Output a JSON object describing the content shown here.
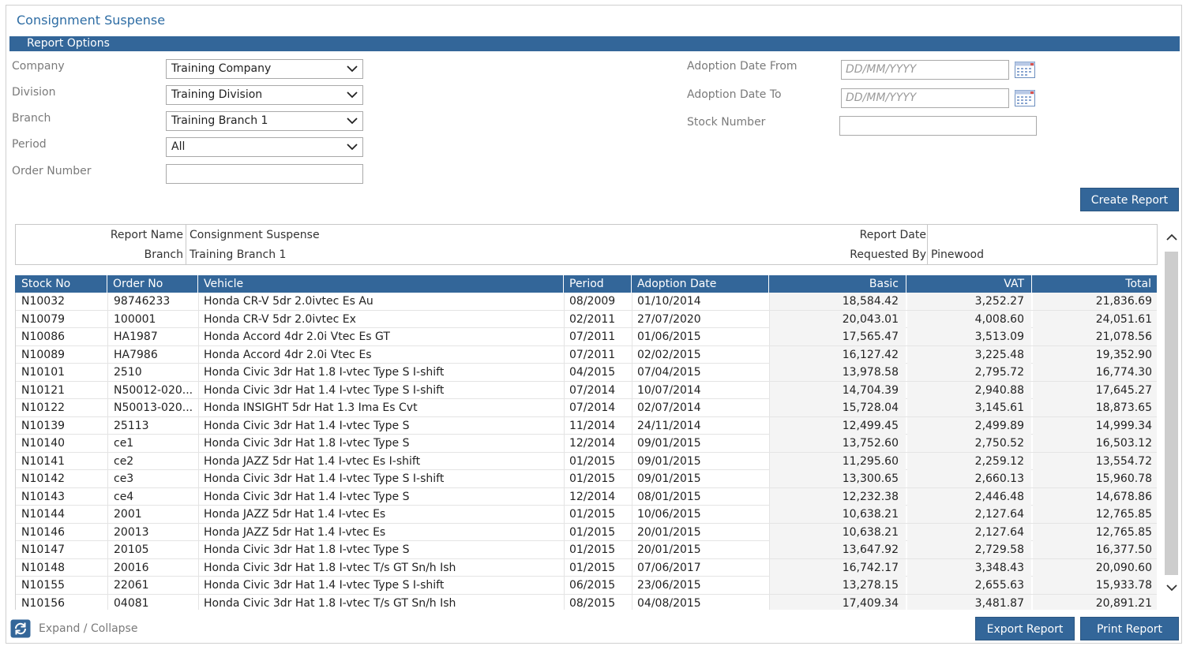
{
  "page": {
    "title": "Consignment Suspense"
  },
  "report_options": {
    "header": "Report Options",
    "company": {
      "label": "Company",
      "value": "Training Company"
    },
    "division": {
      "label": "Division",
      "value": "Training Division"
    },
    "branch": {
      "label": "Branch",
      "value": "Training Branch 1"
    },
    "period": {
      "label": "Period",
      "value": "All"
    },
    "order_number": {
      "label": "Order Number",
      "value": ""
    },
    "adoption_date_from": {
      "label": "Adoption Date From",
      "placeholder": "DD/MM/YYYY"
    },
    "adoption_date_to": {
      "label": "Adoption Date To",
      "placeholder": "DD/MM/YYYY"
    },
    "stock_number": {
      "label": "Stock Number",
      "value": ""
    },
    "create_report_label": "Create Report"
  },
  "report_info": {
    "report_name_label": "Report Name",
    "report_name_value": "Consignment Suspense",
    "branch_label": "Branch",
    "branch_value": "Training Branch 1",
    "report_date_label": "Report Date",
    "report_date_value": "",
    "requested_by_label": "Requested By",
    "requested_by_value": "Pinewood"
  },
  "table": {
    "columns": [
      "Stock No",
      "Order No",
      "Vehicle",
      "Period",
      "Adoption Date",
      "Basic",
      "VAT",
      "Total"
    ],
    "rows": [
      [
        "N10032",
        "98746233",
        "Honda CR-V 5dr 2.0ivtec Es Au",
        "08/2009",
        "01/10/2014",
        "18,584.42",
        "3,252.27",
        "21,836.69"
      ],
      [
        "N10079",
        "100001",
        "Honda CR-V 5dr 2.0ivtec Ex",
        "02/2011",
        "27/07/2020",
        "20,043.01",
        "4,008.60",
        "24,051.61"
      ],
      [
        "N10086",
        "HA1987",
        "Honda Accord 4dr 2.0i Vtec Es GT",
        "07/2011",
        "01/06/2015",
        "17,565.47",
        "3,513.09",
        "21,078.56"
      ],
      [
        "N10089",
        "HA7986",
        "Honda Accord 4dr 2.0i Vtec Es",
        "07/2011",
        "02/02/2015",
        "16,127.42",
        "3,225.48",
        "19,352.90"
      ],
      [
        "N10101",
        "2510",
        "Honda Civic 3dr Hat 1.8 I-vtec Type S I-shift",
        "04/2015",
        "07/04/2015",
        "13,978.58",
        "2,795.72",
        "16,774.30"
      ],
      [
        "N10121",
        "N50012-020...",
        "Honda Civic 3dr Hat 1.4 I-vtec Type S I-shift",
        "07/2014",
        "10/07/2014",
        "14,704.39",
        "2,940.88",
        "17,645.27"
      ],
      [
        "N10122",
        "N50013-020...",
        "Honda INSIGHT 5dr Hat 1.3 Ima Es Cvt",
        "07/2014",
        "02/07/2014",
        "15,728.04",
        "3,145.61",
        "18,873.65"
      ],
      [
        "N10139",
        "25113",
        "Honda Civic 3dr Hat 1.4 I-vtec Type S",
        "11/2014",
        "24/11/2014",
        "12,499.45",
        "2,499.89",
        "14,999.34"
      ],
      [
        "N10140",
        "ce1",
        "Honda Civic 3dr Hat 1.8 I-vtec Type S",
        "12/2014",
        "09/01/2015",
        "13,752.60",
        "2,750.52",
        "16,503.12"
      ],
      [
        "N10141",
        "ce2",
        "Honda JAZZ 5dr Hat 1.4 I-vtec Es I-shift",
        "01/2015",
        "09/01/2015",
        "11,295.60",
        "2,259.12",
        "13,554.72"
      ],
      [
        "N10142",
        "ce3",
        "Honda Civic 3dr Hat 1.4 I-vtec Type S I-shift",
        "01/2015",
        "09/01/2015",
        "13,300.65",
        "2,660.13",
        "15,960.78"
      ],
      [
        "N10143",
        "ce4",
        "Honda Civic 3dr Hat 1.4 I-vtec Type S",
        "12/2014",
        "08/01/2015",
        "12,232.38",
        "2,446.48",
        "14,678.86"
      ],
      [
        "N10144",
        "2001",
        "Honda JAZZ 5dr Hat 1.4 I-vtec Es",
        "01/2015",
        "10/06/2015",
        "10,638.21",
        "2,127.64",
        "12,765.85"
      ],
      [
        "N10146",
        "20013",
        "Honda JAZZ 5dr Hat 1.4 I-vtec Es",
        "01/2015",
        "20/01/2015",
        "10,638.21",
        "2,127.64",
        "12,765.85"
      ],
      [
        "N10147",
        "20105",
        "Honda Civic 3dr Hat 1.8 I-vtec Type S",
        "01/2015",
        "20/01/2015",
        "13,647.92",
        "2,729.58",
        "16,377.50"
      ],
      [
        "N10148",
        "20016",
        "Honda Civic 3dr Hat 1.8 I-vtec T/s GT Sn/h Ish",
        "01/2015",
        "07/06/2017",
        "16,742.17",
        "3,348.43",
        "20,090.60"
      ],
      [
        "N10155",
        "22061",
        "Honda Civic 3dr Hat 1.4 I-vtec Type S I-shift",
        "06/2015",
        "23/06/2015",
        "13,278.15",
        "2,655.63",
        "15,933.78"
      ],
      [
        "N10156",
        "04081",
        "Honda Civic 3dr Hat 1.8 I-vtec T/s GT Sn/h Ish",
        "08/2015",
        "04/08/2015",
        "17,409.34",
        "3,481.87",
        "20,891.21"
      ]
    ]
  },
  "footer": {
    "expand_collapse_label": "Expand / Collapse",
    "export_report_label": "Export Report",
    "print_report_label": "Print Report"
  },
  "colors": {
    "accent": "#336699",
    "title": "#2e6da4"
  }
}
